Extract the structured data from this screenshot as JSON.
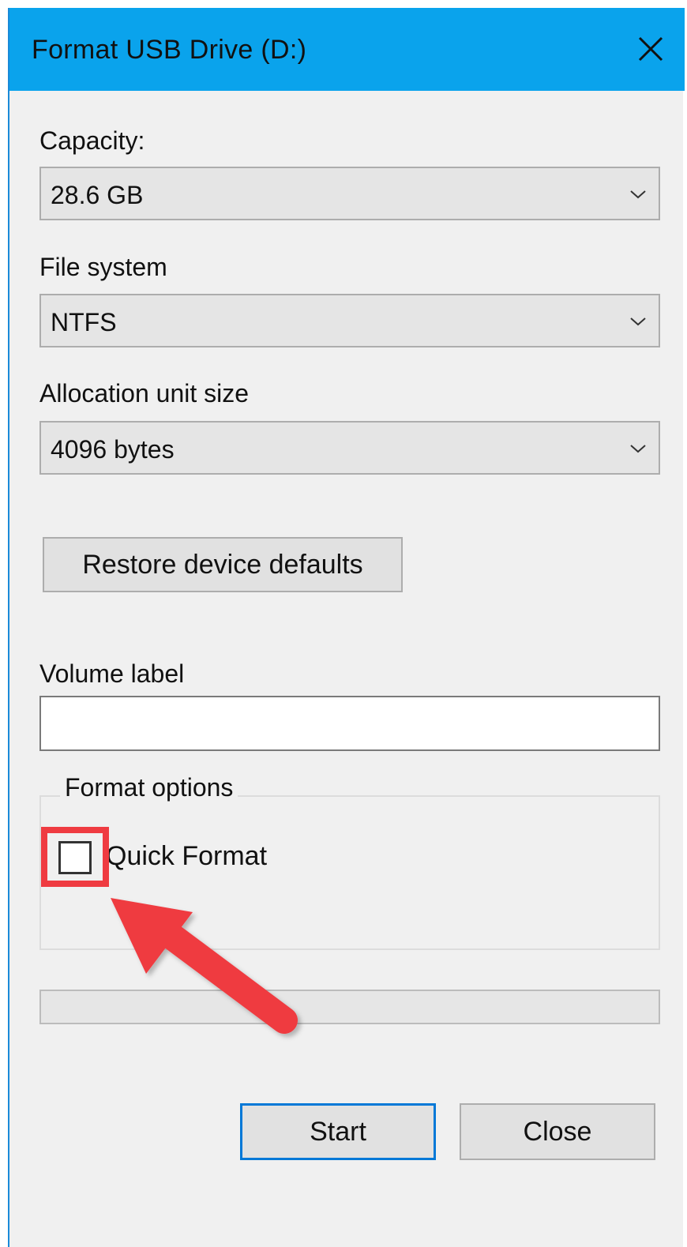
{
  "window": {
    "title": "Format USB Drive (D:)",
    "close_icon": "close-icon"
  },
  "capacity": {
    "label": "Capacity:",
    "value": "28.6 GB"
  },
  "file_system": {
    "label": "File system",
    "value": "NTFS"
  },
  "allocation": {
    "label": "Allocation unit size",
    "value": "4096 bytes"
  },
  "restore_button": "Restore device defaults",
  "volume": {
    "label": "Volume label",
    "value": ""
  },
  "format_options": {
    "legend": "Format options",
    "quick_format_label": "Quick Format",
    "quick_format_checked": false
  },
  "progress": {
    "fraction": 0
  },
  "buttons": {
    "start": "Start",
    "close": "Close"
  },
  "colors": {
    "titlebar": "#0aa3ec",
    "accent_border": "#0078d7",
    "annotation_red": "#ef3b41"
  }
}
